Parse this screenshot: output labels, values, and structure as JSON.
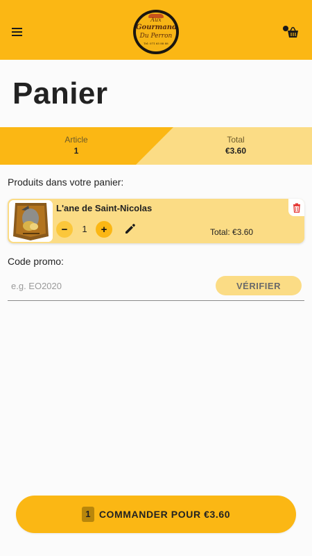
{
  "header": {
    "logo_text": {
      "line1": "Aux",
      "line2": "Gourmandises",
      "line3": "Du Perron",
      "line4": "Tel: 071 65 88 88"
    },
    "menu_icon": "hamburger-menu-icon",
    "cart_icon": "user-basket-icon"
  },
  "page": {
    "title": "Panier"
  },
  "summary": {
    "article_label": "Article",
    "article_value": "1",
    "total_label": "Total",
    "total_value": "€3.60"
  },
  "cart": {
    "section_label": "Produits dans votre panier:",
    "items": [
      {
        "name": "L'ane de Saint-Nicolas",
        "quantity": "1",
        "minus_label": "−",
        "plus_label": "+",
        "line_total": "Total: €3.60",
        "delete_icon": "trash-icon",
        "edit_icon": "pencil-icon"
      }
    ]
  },
  "promo": {
    "label": "Code promo:",
    "placeholder": "e.g. EO2020",
    "value": "",
    "verify_label": "VÉRIFIER"
  },
  "order": {
    "count": "1",
    "label": "COMMANDER POUR €3.60"
  },
  "colors": {
    "accent": "#fbb714",
    "accent_light": "#fbdc85",
    "delete": "#e53935"
  }
}
